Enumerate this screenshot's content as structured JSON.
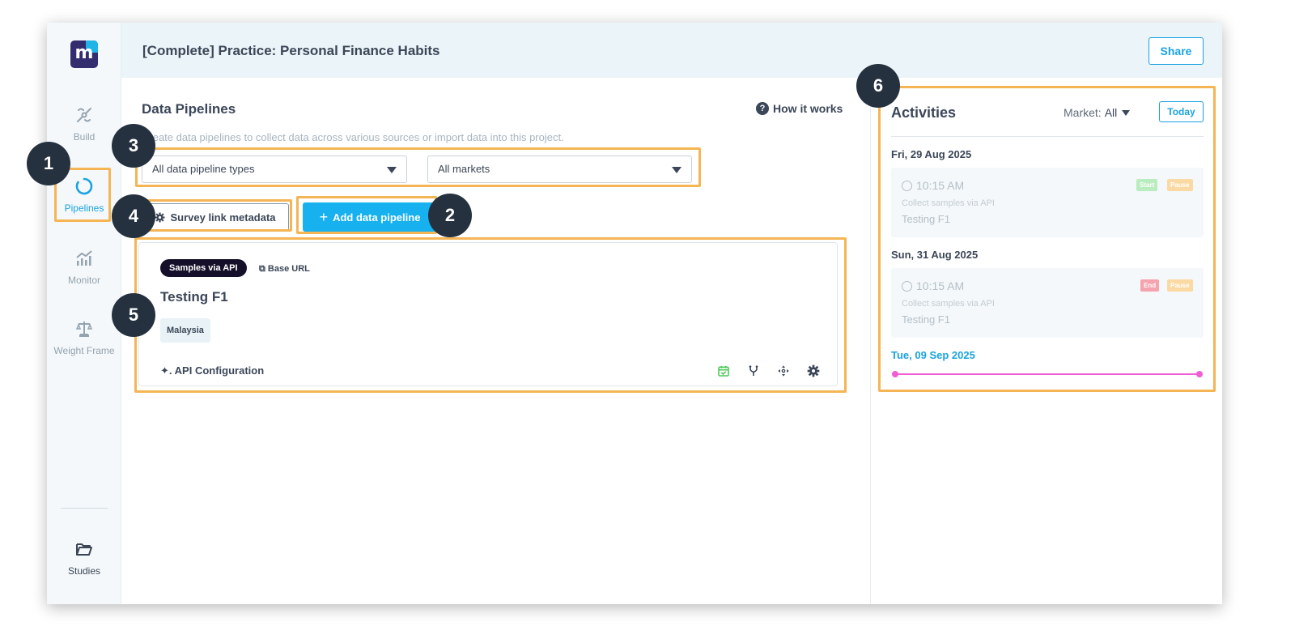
{
  "header": {
    "title": "[Complete] Practice: Personal Finance Habits",
    "share_label": "Share"
  },
  "logo": {
    "letter": "m"
  },
  "sidebar": {
    "items": [
      {
        "label": "Build",
        "icon": "build-icon"
      },
      {
        "label": "Pipelines",
        "icon": "pipelines-icon",
        "active": true
      },
      {
        "label": "Monitor",
        "icon": "monitor-chart-icon"
      },
      {
        "label": "Weight Frame",
        "icon": "scale-icon"
      },
      {
        "label": "Studies",
        "icon": "folder-open-icon"
      }
    ]
  },
  "main": {
    "title": "Data Pipelines",
    "how_it_works": "How it works",
    "subtitle": "Create data pipelines to collect data across various sources or import data into this project.",
    "filters": {
      "type": "All data pipeline types",
      "market": "All markets"
    },
    "survey_link_label": "Survey link metadata",
    "add_pipeline_label": "Add data pipeline",
    "card": {
      "tag": "Samples via API",
      "base_url": "Base URL",
      "title": "Testing F1",
      "market_tag": "Malaysia",
      "api_config": "API Configuration"
    }
  },
  "activities": {
    "title": "Activities",
    "market_label": "Market:",
    "market_value": "All",
    "today_label": "Today",
    "days": [
      {
        "date": "Fri, 29 Aug 2025",
        "time": "10:15 AM",
        "desc": "Collect samples via API",
        "name": "Testing F1",
        "badge1": "Start",
        "badge2": "Pause"
      },
      {
        "date": "Sun, 31 Aug 2025",
        "time": "10:15 AM",
        "desc": "Collect samples via API",
        "name": "Testing F1",
        "badge1": "End",
        "badge2": "Pause"
      }
    ],
    "today_date": "Tue, 09 Sep 2025"
  },
  "annotations": [
    "1",
    "2",
    "3",
    "4",
    "5",
    "6"
  ],
  "colors": {
    "accent": "#16b1ee",
    "highlight": "#f5b555",
    "marker": "#25313f",
    "timeline": "#ef5fd3"
  }
}
